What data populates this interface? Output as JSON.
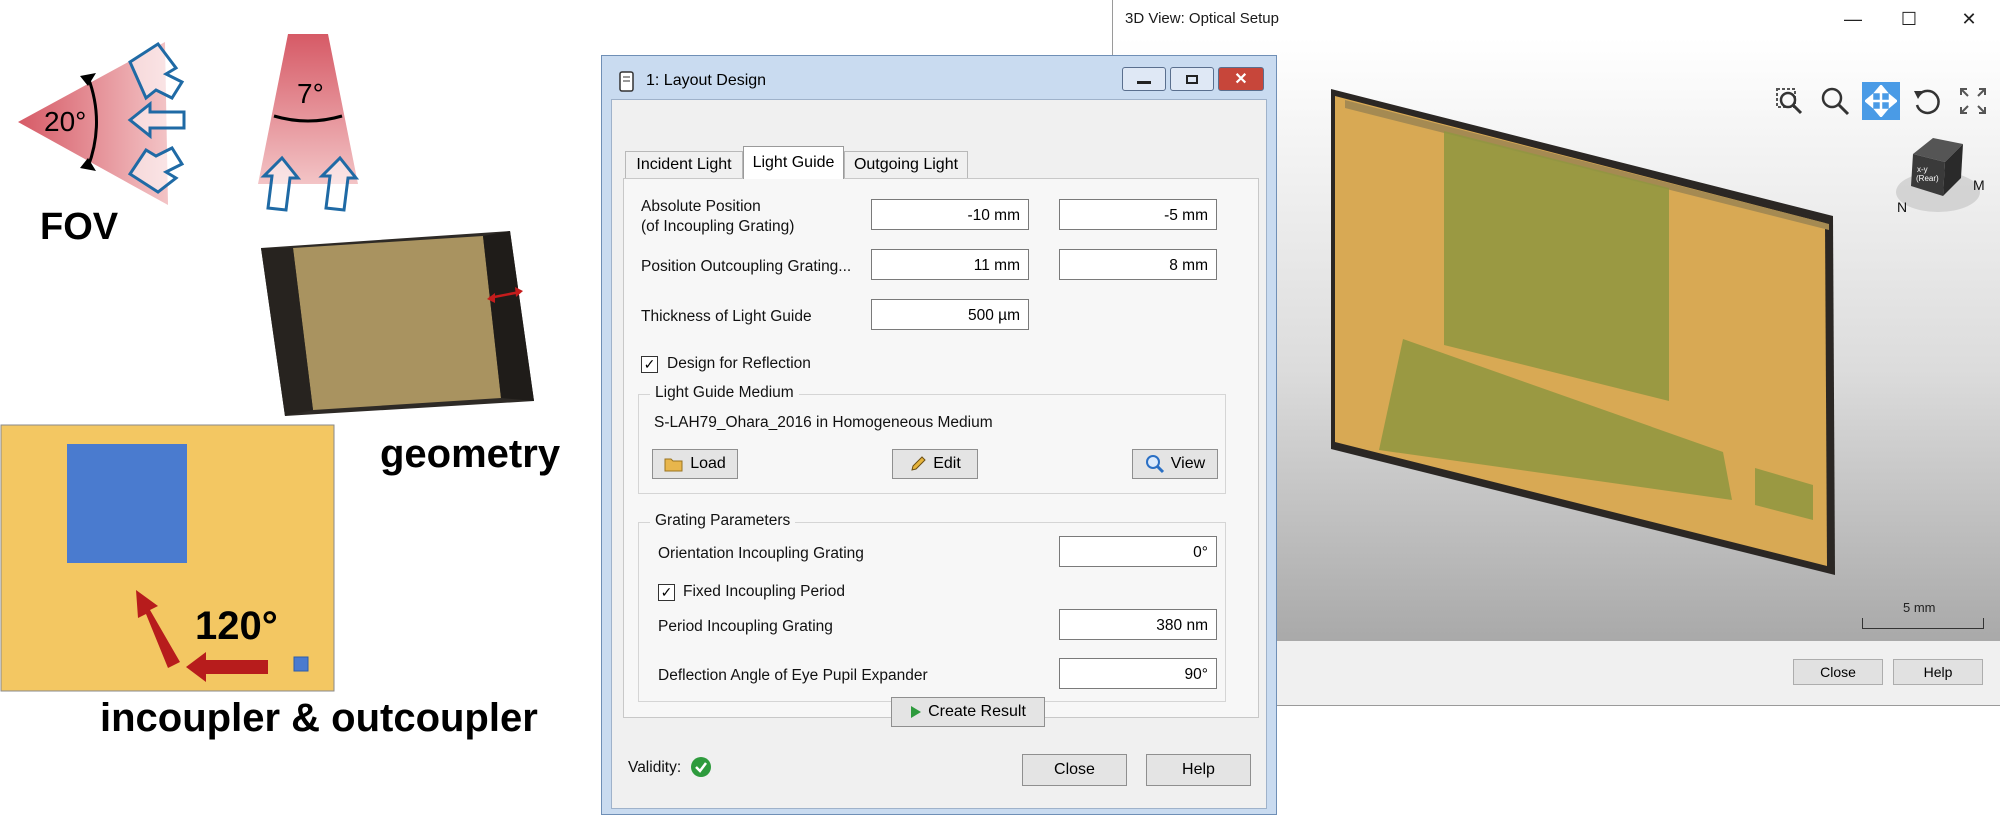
{
  "illustration": {
    "fov_label": "FOV",
    "angle_horizontal": "20°",
    "angle_vertical": "7°",
    "geometry_label": "geometry",
    "rotation_angle": "120°",
    "coupler_label": "incoupler & outcoupler"
  },
  "view3d": {
    "title": "3D View: Optical Setup",
    "cube_label": "x-y (Rear)",
    "scale_label": "5 mm",
    "close_label": "Close",
    "help_label": "Help",
    "tools": [
      "zoom-window-icon",
      "zoom-icon",
      "pan-icon",
      "rotate-icon",
      "fit-view-icon"
    ]
  },
  "dialog": {
    "title": "1: Layout Design",
    "tabs": [
      "Incident Light",
      "Light Guide",
      "Outgoing Light"
    ],
    "active_tab": "Light Guide",
    "abs_position_label": "Absolute Position",
    "abs_position_sublabel": "(of Incoupling Grating)",
    "abs_position_x": "-10 mm",
    "abs_position_y": "-5 mm",
    "outcoupling_label": "Position Outcoupling Grating...",
    "outcoupling_x": "11 mm",
    "outcoupling_y": "8 mm",
    "thickness_label": "Thickness of Light Guide",
    "thickness_value": "500 µm",
    "design_reflection_label": "Design for Reflection",
    "design_reflection_checked": true,
    "medium_group": "Light Guide Medium",
    "medium_value": "S-LAH79_Ohara_2016 in Homogeneous Medium",
    "load_label": "Load",
    "edit_label": "Edit",
    "view_label": "View",
    "grating_group": "Grating Parameters",
    "orientation_label": "Orientation Incoupling Grating",
    "orientation_value": "0°",
    "fixed_period_label": "Fixed Incoupling Period",
    "fixed_period_checked": true,
    "period_label": "Period Incoupling Grating",
    "period_value": "380 nm",
    "deflection_label": "Deflection Angle of Eye Pupil Expander",
    "deflection_value": "90°",
    "create_label": "Create Result",
    "validity_label": "Validity:",
    "close_label": "Close",
    "help_label": "Help"
  },
  "colors": {
    "fov_red": "#d9616b",
    "arrow_blue": "#1f6aa5",
    "waveguide_tan": "#a99360",
    "waveguide_edge": "#2e2a26",
    "coupler_yellow": "#f3c762",
    "coupler_blue": "#4a7bcf",
    "rotation_arrow": "#b71c1c",
    "accent_blue": "#4a9be6",
    "valid_green": "#2e9b3d"
  }
}
